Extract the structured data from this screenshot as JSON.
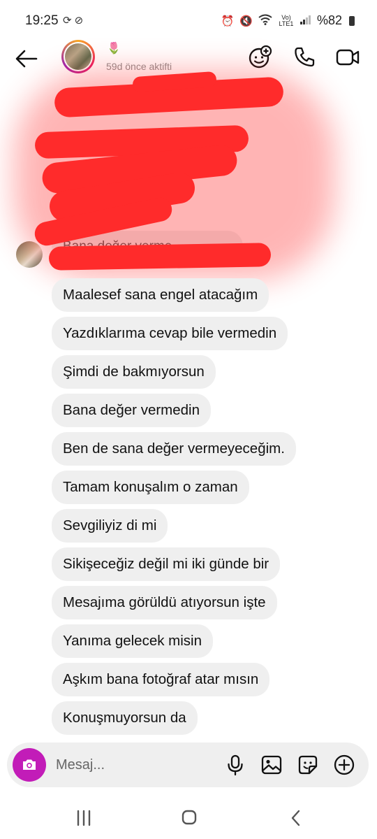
{
  "status_bar": {
    "time": "19:25",
    "left_icons": [
      "sync-icon",
      "block-icon"
    ],
    "right_icons": [
      "alarm-icon",
      "mute-icon",
      "wifi-icon",
      "volte-icon",
      "signal-icon"
    ],
    "volte_label": "Vo) LTE1",
    "battery": "%82"
  },
  "header": {
    "contact_emoji": "🌷",
    "contact_status": "59d önce aktifti"
  },
  "redacted": {
    "partial_text": "Bana değer verme..."
  },
  "messages": [
    "Maalesef sana engel atacağım",
    "Yazdıklarıma cevap bile vermedin",
    "Şimdi de bakmıyorsun",
    "Bana değer vermedin",
    "Ben de sana değer vermeyeceğim.",
    "Tamam konuşalım o zaman",
    "Sevgiliyiz di mi",
    "Sikişeceğiz değil mi iki günde bir",
    "Mesajıma görüldü atıyorsun işte",
    "Yanıma gelecek misin",
    "Aşkım bana fotoğraf atar mısın",
    "Konuşmuyorsun da"
  ],
  "composer": {
    "placeholder": "Mesaj..."
  },
  "colors": {
    "accent": "#c21cb8",
    "bubble": "#efefef",
    "redaction": "#ff2b2b"
  }
}
